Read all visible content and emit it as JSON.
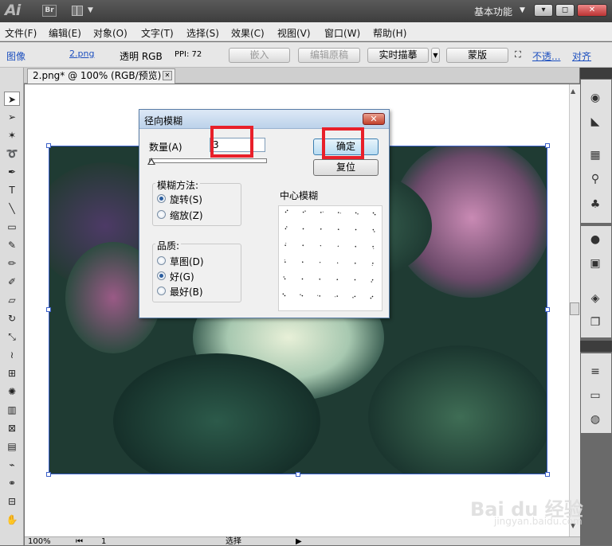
{
  "app": {
    "logo": "Ai",
    "bridge_label": "Br",
    "workspace": "基本功能",
    "window_buttons": [
      "▾",
      "◻",
      "✕"
    ]
  },
  "menu": [
    "文件(F)",
    "编辑(E)",
    "对象(O)",
    "文字(T)",
    "选择(S)",
    "效果(C)",
    "视图(V)",
    "窗口(W)",
    "帮助(H)"
  ],
  "control_bar": {
    "type_label": "图像",
    "filename": "2.png",
    "mode": "透明 RGB",
    "ppi": "PPI: 72",
    "embed": "嵌入",
    "edit_original": "编辑原稿",
    "live_trace": "实时描摹",
    "mask": "蒙版",
    "opacity": "不透...",
    "align": "对齐"
  },
  "document_tab": {
    "title": "2.png* @ 100% (RGB/预览)",
    "close": "✕"
  },
  "dialog": {
    "title": "径向模糊",
    "amount_label": "数量(A)",
    "amount_value": "3",
    "ok": "确定",
    "reset": "复位",
    "blur_method_label": "模糊方法:",
    "methods": [
      "旋转(S)",
      "缩放(Z)"
    ],
    "selected_method": "旋转(S)",
    "quality_label": "品质:",
    "qualities": [
      "草图(D)",
      "好(G)",
      "最好(B)"
    ],
    "selected_quality": "好(G)",
    "center_label": "中心模糊"
  },
  "status_bar": {
    "zoom": "100%",
    "page": "1",
    "tool": "选择"
  },
  "watermark": {
    "brand": "Bai du 经验",
    "url": "jingyan.baidu.com"
  },
  "tools": [
    "selection-icon",
    "direct-selection-icon",
    "magic-wand-icon",
    "lasso-icon",
    "pen-icon",
    "type-icon",
    "line-icon",
    "rectangle-icon",
    "paintbrush-icon",
    "pencil-icon",
    "blob-brush-icon",
    "eraser-icon",
    "rotate-icon",
    "scale-icon",
    "warp-icon",
    "free-transform-icon",
    "symbol-sprayer-icon",
    "column-graph-icon",
    "mesh-icon",
    "gradient-icon",
    "eyedropper-icon",
    "blend-icon",
    "slice-icon",
    "hand-icon"
  ],
  "colors": {
    "highlight": "#e8202a",
    "link": "#1c4fbf",
    "selection": "#3a5fc9"
  }
}
